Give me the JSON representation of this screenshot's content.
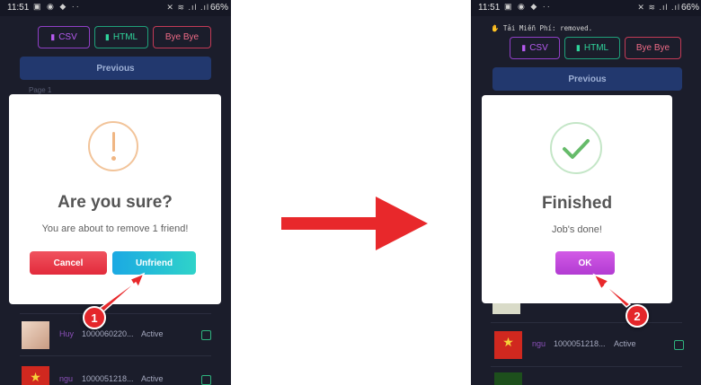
{
  "before": {
    "status_bar": {
      "time": "11:51",
      "left_icons": "▣ ◉ ◆ ··",
      "right_icons": "✕ ≋ .ıl .ıl",
      "battery": "66%"
    },
    "toolbar": {
      "csv_label": "CSV",
      "html_label": "HTML",
      "bye_label": "Bye Bye"
    },
    "previous_label": "Previous",
    "page_label": "Page 1",
    "dialog": {
      "title": "Are you sure?",
      "message": "You are about to remove 1 friend!",
      "cancel_label": "Cancel",
      "confirm_label": "Unfriend"
    },
    "step_badge": "1",
    "rows": [
      {
        "name": "Huy",
        "id": "1000060220...",
        "status": "Active"
      },
      {
        "name": "ngu",
        "id": "1000051218...",
        "status": "Active"
      }
    ]
  },
  "after": {
    "status_bar": {
      "time": "11:51",
      "left_icons": "▣ ◉ ◆ ··",
      "right_icons": "✕ ≋ .ıl .ıl",
      "battery": "66%"
    },
    "removed_message": "✋ Tải Miễn Phí: removed.",
    "toolbar": {
      "csv_label": "CSV",
      "html_label": "HTML",
      "bye_label": "Bye Bye"
    },
    "previous_label": "Previous",
    "dialog": {
      "title": "Finished",
      "message": "Job's done!",
      "ok_label": "OK"
    },
    "step_badge": "2",
    "rows": [
      {
        "name": "ngu",
        "id": "1000051218...",
        "status": "Active"
      }
    ]
  },
  "colors": {
    "app_background": "#1b1d2b",
    "arrow": "#e8282b",
    "warning": "#f0b683",
    "success": "#66bb6a",
    "unfriend_button": "#1ba9e3",
    "ok_button": "#c04ad9",
    "cancel_button": "#e8323f"
  }
}
